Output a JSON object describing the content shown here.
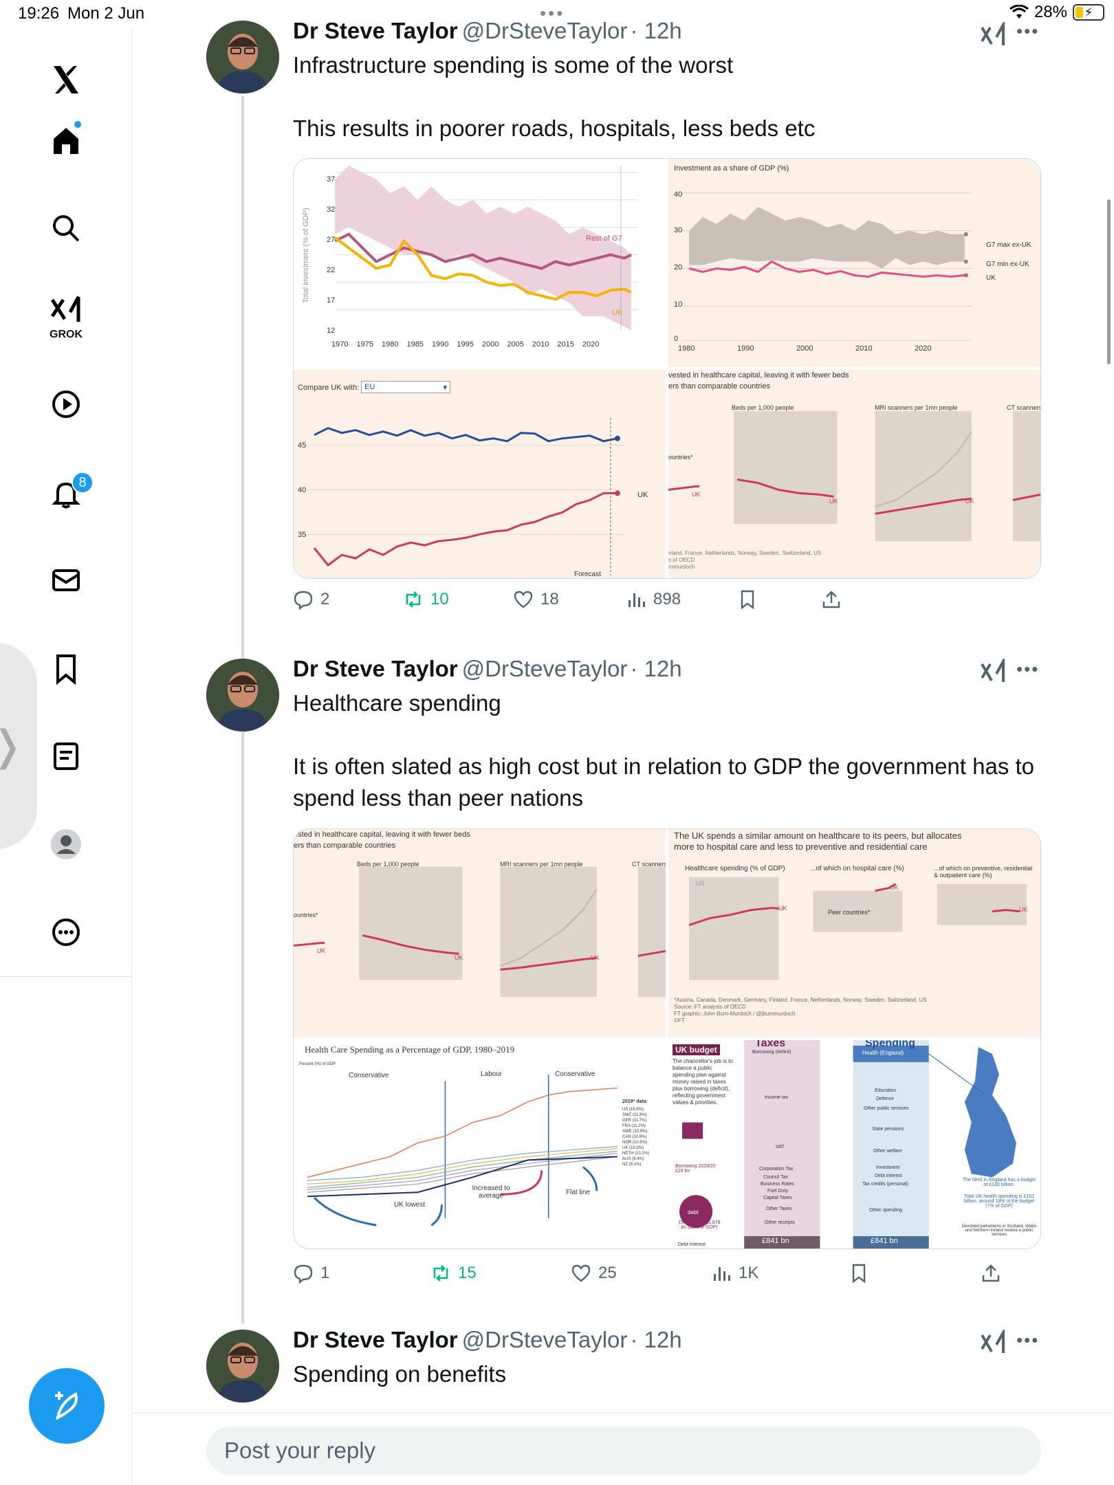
{
  "status_bar": {
    "time": "19:26",
    "date": "Mon 2 Jun",
    "battery": "28%",
    "battery_level": 0.28
  },
  "sidebar": {
    "items": [
      {
        "name": "home",
        "icon": "home-icon"
      },
      {
        "name": "explore",
        "icon": "search-icon"
      },
      {
        "name": "grok",
        "icon": "grok-icon",
        "label": "GROK"
      },
      {
        "name": "video",
        "icon": "play-icon"
      },
      {
        "name": "notifications",
        "icon": "bell-icon",
        "badge": "8"
      },
      {
        "name": "messages",
        "icon": "mail-icon"
      },
      {
        "name": "bookmarks",
        "icon": "bookmark-icon"
      },
      {
        "name": "articles",
        "icon": "article-icon"
      },
      {
        "name": "profile",
        "icon": "profile-icon"
      },
      {
        "name": "more",
        "icon": "more-icon"
      }
    ],
    "compose_icon": "compose-icon"
  },
  "tweets": [
    {
      "author": {
        "name": "Dr Steve Taylor",
        "handle": "@DrSteveTaylor",
        "time": "· 12h"
      },
      "paragraphs": [
        "Infrastructure spending is some of the worst",
        "This results in poorer roads, hospitals, less beds etc"
      ],
      "media": {
        "a": {
          "ylabel": "Total investment (% of GDP)",
          "yticks": [
            "37",
            "32",
            "27",
            "22",
            "17",
            "12"
          ],
          "xticks": [
            "1970",
            "1975",
            "1980",
            "1985",
            "1990",
            "1995",
            "2000",
            "2005",
            "2010",
            "2015",
            "2020"
          ],
          "label_rest": "Rest of G7",
          "label_uk": "UK"
        },
        "b": {
          "title": "Investment as a share of GDP (%)",
          "yticks": [
            "40",
            "30",
            "20",
            "10",
            "0"
          ],
          "xticks": [
            "1980",
            "1990",
            "2000",
            "2010",
            "2020"
          ],
          "legend": [
            "G7 max ex-UK",
            "G7 min ex-UK",
            "UK"
          ]
        },
        "c": {
          "compare_label": "Compare UK with:",
          "compare_value": "EU",
          "yticks": [
            "45",
            "40",
            "35"
          ],
          "uk_label": "UK",
          "forecast_label": "Forecast"
        },
        "d": {
          "title": [
            "vested in healthcare capital, leaving it with fewer beds",
            "ers than comparable countries"
          ],
          "panels": [
            "Beds per 1,000 people",
            "MRI scanners per 1mn people",
            "CT scanners"
          ],
          "footnote": [
            "nland, France, Netherlands, Norway, Sweden, Switzerland, US",
            "s of OECD",
            "rnmurdoch"
          ],
          "uk_label": "UK",
          "countries_label": "ountries*"
        }
      },
      "stats": {
        "replies": "2",
        "reposts": "10",
        "likes": "18",
        "views": "898"
      }
    },
    {
      "author": {
        "name": "Dr Steve Taylor",
        "handle": "@DrSteveTaylor",
        "time": "· 12h"
      },
      "paragraphs": [
        "Healthcare spending",
        "It is often slated as high cost but in relation to GDP the government has to spend less than peer nations"
      ],
      "media": {
        "a": {
          "title": [
            "ested in healthcare capital, leaving it with fewer beds",
            "ers than comparable countries"
          ],
          "panels": [
            "Beds per 1,000 people",
            "MRI scanners per 1mn people",
            "CT scanners"
          ],
          "uk_label": "UK",
          "countries_label": "ountries*"
        },
        "b": {
          "title": [
            "The UK spends a similar amount on healthcare to its peers, but allocates",
            "more to hospital care and less to preventive and residential care"
          ],
          "panels": [
            "Healthcare spending (% of GDP)",
            "...of which on hospital care (%)",
            "...of which on preventive, residential & outpatient care (%)"
          ],
          "us_label": "US",
          "uk_label": "UK",
          "peer_label": "Peer countries*",
          "source": [
            "*Austria, Canada, Denmark, Germany, Finland, France, Netherlands, Norway, Sweden, Switzerland, US",
            "Source: FT analysis of OECD",
            "FT graphic: John Burn-Murdoch / @jburnmurdoch",
            "©FT"
          ]
        },
        "c": {
          "title": "Health Care Spending as a Percentage of GDP, 1980–2019",
          "ylabel": "Percent (%) of GDP",
          "eras": [
            "Conservative",
            "Labour",
            "Conservative"
          ],
          "annotations": [
            "UK lowest",
            "Increased to average",
            "Flat line"
          ],
          "legend_title": "2019* data:",
          "legend": [
            "US (16.8%)",
            "SWZ (11.9%)",
            "GER (11.7%)",
            "FRA (11.2%)",
            "SWE (10.9%)",
            "CAN (10.8%)",
            "NOR (10.5%)",
            "UK (10.2%)",
            "NETH (10.2%)",
            "AUS (9.4%)",
            "NZ (9.1%)"
          ]
        },
        "d": {
          "uk_budget": "UK budget",
          "budget_text": "The chancellor's job is to balance a public spending plan against money raised in taxes plus borrowing (deficit), reflecting government values & priorities.",
          "taxes_title": "Taxes",
          "spending_title": "Spending",
          "tax_items": [
            "Borrowing (deficit)",
            "Income tax",
            "VAT",
            "Corporation Tax",
            "Council Tax",
            "Business Rates",
            "Fuel Duty",
            "Capital Taxes",
            "Other Taxes",
            "Other receipts"
          ],
          "spend_items": [
            "Health (England)",
            "Education",
            "Defence",
            "Other public services",
            "State pensions",
            "Other welfare",
            "Investment",
            "Debt interest",
            "Tax credits (personal)",
            "Other spending"
          ],
          "total_taxes": "£841 bn",
          "total_spending": "£841 bn",
          "borrowing": "Borrowing 2019/20 £29 bn",
          "deficit": "deficit",
          "debt": "debt",
          "overall_debt": "Overall debt £1,878 bn (82% of GDP)",
          "debt_interest": "Debt Interest",
          "nhs_note": "The NHS in England has a budget of £130 billion.",
          "uk_health_note": "Total UK health spending is £151 billion, around 18% of the budget (7% of GDP)",
          "devolved_note": "Devolved parliaments in Scotland, Wales and Northern Ireland receive a public services"
        }
      },
      "stats": {
        "replies": "1",
        "reposts": "15",
        "likes": "25",
        "views": "1K"
      }
    },
    {
      "author": {
        "name": "Dr Steve Taylor",
        "handle": "@DrSteveTaylor",
        "time": "· 12h"
      },
      "paragraphs": [
        "Spending on benefits"
      ]
    }
  ],
  "reply_placeholder": "Post your reply",
  "colors": {
    "accent": "#1d9bf0",
    "repost": "#00ba7c",
    "text": "#0f1419",
    "muted": "#536471",
    "chart_bg": "#fdf1e7",
    "uk_red": "#d0365e",
    "uk_yellow": "#f5b400"
  }
}
